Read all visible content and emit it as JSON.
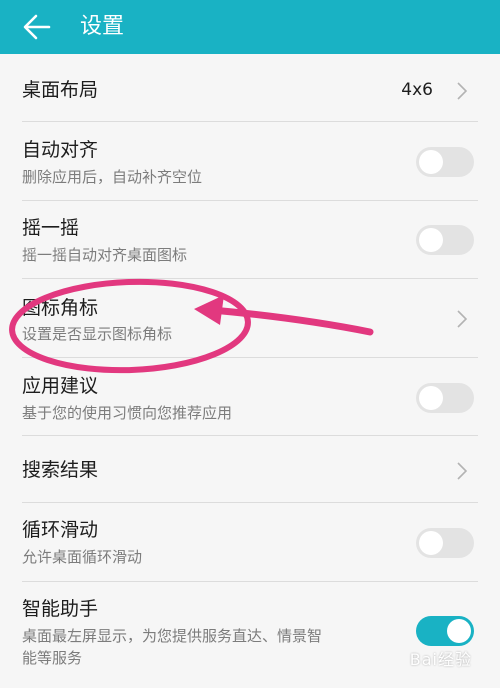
{
  "header": {
    "title": "设置",
    "back_icon": "arrow-left-icon",
    "color": "#19b2c4"
  },
  "settings": [
    {
      "title": "桌面布局",
      "subtitle": "",
      "value": "4x6",
      "control": "chevron"
    },
    {
      "title": "自动对齐",
      "subtitle": "删除应用后，自动补齐空位",
      "control": "toggle",
      "state": "off"
    },
    {
      "title": "摇一摇",
      "subtitle": "摇一摇自动对齐桌面图标",
      "control": "toggle",
      "state": "off"
    },
    {
      "title": "图标角标",
      "subtitle": "设置是否显示图标角标",
      "control": "chevron"
    },
    {
      "title": "应用建议",
      "subtitle": "基于您的使用习惯向您推荐应用",
      "control": "toggle",
      "state": "off"
    },
    {
      "title": "搜索结果",
      "subtitle": "",
      "control": "chevron"
    },
    {
      "title": "循环滑动",
      "subtitle": "允许桌面循环滑动",
      "control": "toggle",
      "state": "off"
    },
    {
      "title": "智能助手",
      "subtitle": "桌面最左屏显示，为您提供服务直达、情景智",
      "subtitle2": "能等服务",
      "control": "toggle",
      "state": "on"
    }
  ],
  "annotation_color": "#e2387f",
  "watermark": "Bai经验"
}
